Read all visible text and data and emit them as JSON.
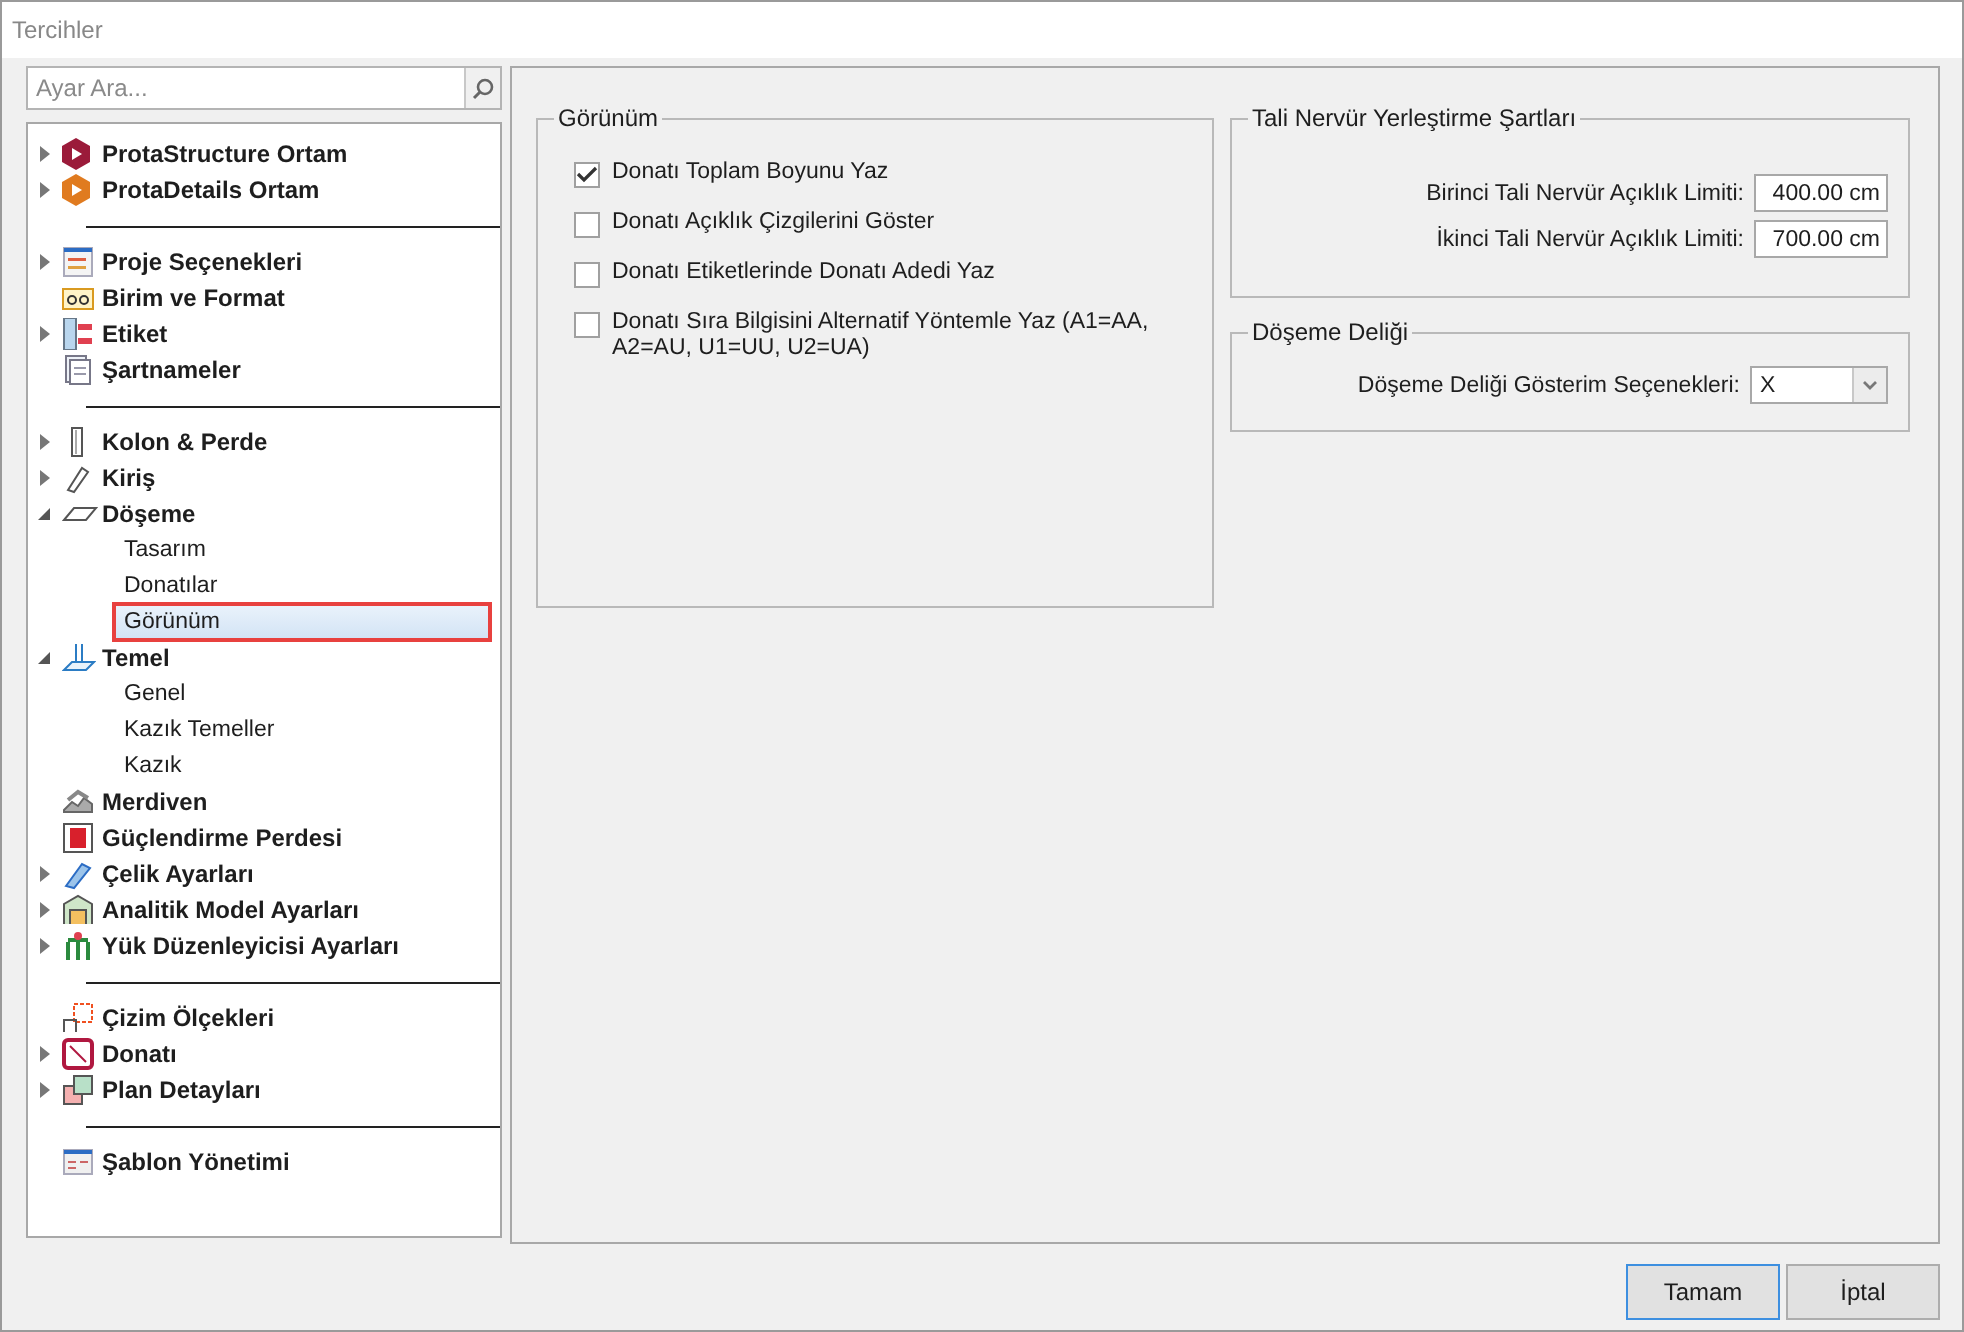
{
  "window": {
    "title": "Tercihler"
  },
  "search": {
    "placeholder": "Ayar Ara..."
  },
  "tree": {
    "groups": [
      {
        "items": [
          {
            "label": "ProtaStructure Ortam",
            "expanded": false
          },
          {
            "label": "ProtaDetails Ortam",
            "expanded": false
          }
        ]
      },
      {
        "items": [
          {
            "label": "Proje Seçenekleri",
            "expanded": false
          },
          {
            "label": "Birim ve Format"
          },
          {
            "label": "Etiket",
            "expanded": false
          },
          {
            "label": "Şartnameler"
          }
        ]
      },
      {
        "items": [
          {
            "label": "Kolon & Perde",
            "expanded": false
          },
          {
            "label": "Kiriş",
            "expanded": false
          },
          {
            "label": "Döşeme",
            "expanded": true,
            "children": [
              {
                "label": "Tasarım",
                "selected": false
              },
              {
                "label": "Donatılar",
                "selected": false
              },
              {
                "label": "Görünüm",
                "selected": true
              }
            ]
          },
          {
            "label": "Temel",
            "expanded": true,
            "children": [
              {
                "label": "Genel",
                "selected": false
              },
              {
                "label": "Kazık Temeller",
                "selected": false
              },
              {
                "label": "Kazık",
                "selected": false
              }
            ]
          },
          {
            "label": "Merdiven"
          },
          {
            "label": "Güçlendirme Perdesi"
          },
          {
            "label": "Çelik Ayarları",
            "expanded": false
          },
          {
            "label": "Analitik Model Ayarları",
            "expanded": false
          },
          {
            "label": "Yük Düzenleyicisi Ayarları",
            "expanded": false
          }
        ]
      },
      {
        "items": [
          {
            "label": "Çizim Ölçekleri"
          },
          {
            "label": "Donatı",
            "expanded": false
          },
          {
            "label": "Plan Detayları",
            "expanded": false
          }
        ]
      },
      {
        "items": [
          {
            "label": "Şablon Yönetimi"
          }
        ]
      }
    ]
  },
  "view_group": {
    "title": "Görünüm",
    "options": [
      {
        "label": "Donatı Toplam Boyunu Yaz",
        "checked": true
      },
      {
        "label": "Donatı Açıklık Çizgilerini Göster",
        "checked": false
      },
      {
        "label": "Donatı Etiketlerinde Donatı Adedi Yaz",
        "checked": false
      },
      {
        "label": "Donatı Sıra Bilgisini Alternatif Yöntemle Yaz (A1=AA, A2=AU, U1=UU, U2=UA)",
        "checked": false
      }
    ]
  },
  "rib_group": {
    "title": "Tali Nervür Yerleştirme Şartları",
    "fields": [
      {
        "label": "Birinci Tali Nervür Açıklık Limiti:",
        "value": "400.00 cm"
      },
      {
        "label": "İkinci Tali Nervür Açıklık Limiti:",
        "value": "700.00 cm"
      }
    ]
  },
  "hole_group": {
    "title": "Döşeme Deliği",
    "field": {
      "label": "Döşeme Deliği Gösterim Seçenekleri:",
      "value": "X"
    }
  },
  "buttons": [
    {
      "label": "Tamam",
      "focused": true
    },
    {
      "label": "İptal",
      "focused": false
    }
  ]
}
